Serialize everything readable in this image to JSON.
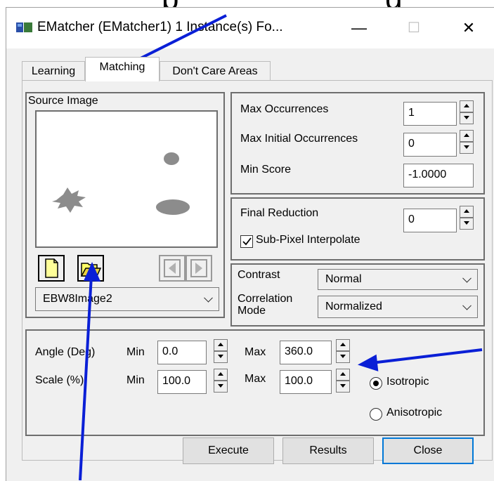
{
  "window": {
    "title": "EMatcher (EMatcher1) 1 Instance(s) Fo...",
    "minimize_glyph": "—",
    "maximize_glyph": "☐",
    "close_glyph": "✕"
  },
  "tabs": [
    {
      "label": "Learning"
    },
    {
      "label": "Matching"
    },
    {
      "label": "Don't Care Areas"
    }
  ],
  "source_image": {
    "label": "Source Image",
    "selected_image": "EBW8Image2"
  },
  "matching_params": {
    "max_occurrences_label": "Max Occurrences",
    "max_occurrences_value": "1",
    "max_initial_occurrences_label": "Max Initial Occurrences",
    "max_initial_occurrences_value": "0",
    "min_score_label": "Min Score",
    "min_score_value": "-1.0000"
  },
  "reduction": {
    "final_reduction_label": "Final Reduction",
    "final_reduction_value": "0",
    "subpixel_label": "Sub-Pixel Interpolate",
    "subpixel_checked": true
  },
  "contrast": {
    "contrast_label": "Contrast",
    "contrast_value": "Normal",
    "correlation_label_line1": "Correlation",
    "correlation_label_line2": "Mode",
    "correlation_value": "Normalized"
  },
  "angle_scale": {
    "angle_label": "Angle (Deg)",
    "scale_label": "Scale (%)",
    "min_label": "Min",
    "max_label": "Max",
    "angle_min": "0.0",
    "angle_max": "360.0",
    "scale_min": "100.0",
    "scale_max": "100.0",
    "isotropic_label": "Isotropic",
    "anisotropic_label": "Anisotropic",
    "isotropic_selected": true
  },
  "buttons": {
    "execute": "Execute",
    "results": "Results",
    "close": "Close"
  },
  "colors": {
    "annotation_arrow": "#0a1fd6",
    "default_button_border": "#0078d7",
    "file_icon_fill": "#ffff99"
  }
}
